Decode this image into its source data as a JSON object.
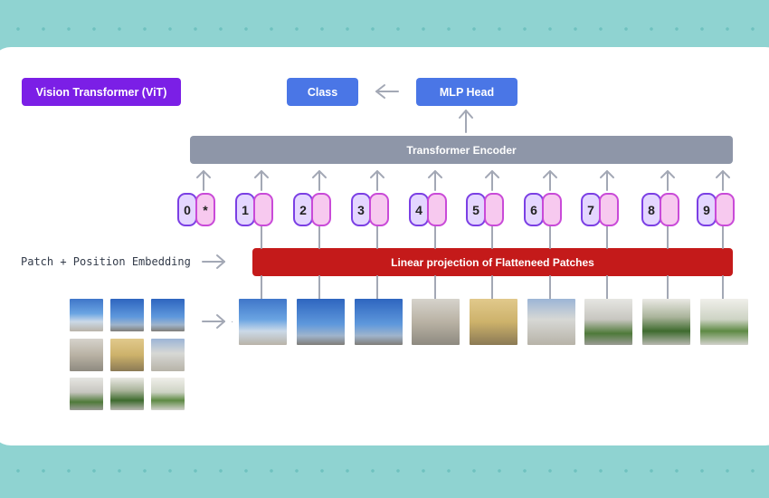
{
  "title": "Vision Transformer (ViT)",
  "class_label": "Class",
  "mlp_head_label": "MLP Head",
  "encoder_label": "Transformer Encoder",
  "projection_label": "Linear projection of Flatteneed Patches",
  "embedding_label": "Patch + Position Embedding",
  "tokens": [
    {
      "pos": "0",
      "emb": "*"
    },
    {
      "pos": "1",
      "emb": ""
    },
    {
      "pos": "2",
      "emb": ""
    },
    {
      "pos": "3",
      "emb": ""
    },
    {
      "pos": "4",
      "emb": ""
    },
    {
      "pos": "5",
      "emb": ""
    },
    {
      "pos": "6",
      "emb": ""
    },
    {
      "pos": "7",
      "emb": ""
    },
    {
      "pos": "8",
      "emb": ""
    },
    {
      "pos": "9",
      "emb": ""
    }
  ],
  "colors": {
    "background": "#8fd3d1",
    "title": "#7b1fe6",
    "blue_button": "#4a76e6",
    "encoder": "#8e96a8",
    "projection": "#c41a1a",
    "position_token": "#e4d6ff",
    "embedding_token": "#f7c9ef",
    "arrow": "#a3a8b5"
  }
}
